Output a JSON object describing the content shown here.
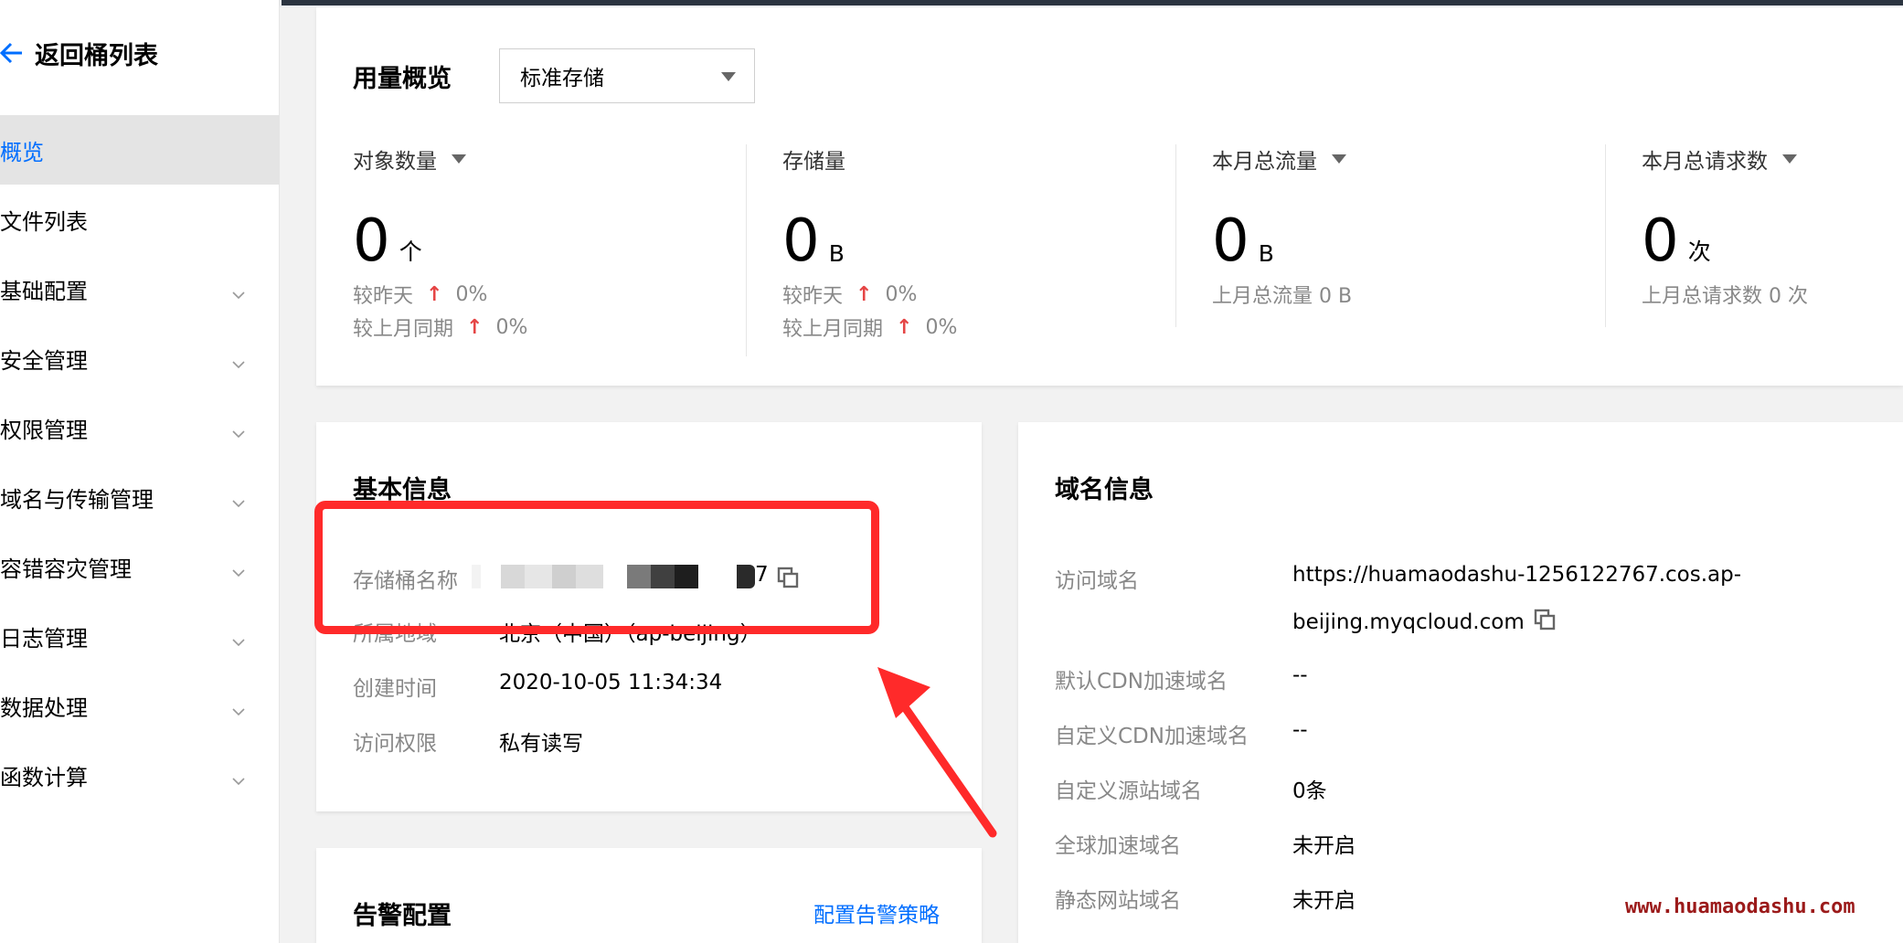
{
  "sidebar": {
    "back_label": "返回桶列表",
    "items": [
      {
        "label": "概览",
        "active": true,
        "has_chevron": false
      },
      {
        "label": "文件列表",
        "active": false,
        "has_chevron": false
      },
      {
        "label": "基础配置",
        "active": false,
        "has_chevron": true
      },
      {
        "label": "安全管理",
        "active": false,
        "has_chevron": true
      },
      {
        "label": "权限管理",
        "active": false,
        "has_chevron": true
      },
      {
        "label": "域名与传输管理",
        "active": false,
        "has_chevron": true
      },
      {
        "label": "容错容灾管理",
        "active": false,
        "has_chevron": true
      },
      {
        "label": "日志管理",
        "active": false,
        "has_chevron": true
      },
      {
        "label": "数据处理",
        "active": false,
        "has_chevron": true
      },
      {
        "label": "函数计算",
        "active": false,
        "has_chevron": true
      }
    ]
  },
  "usage": {
    "title": "用量概览",
    "storage_type": "标准存储",
    "stats": {
      "objects": {
        "label": "对象数量",
        "value": "0",
        "unit": "个",
        "line1_label": "较昨天",
        "line1_value": "0%",
        "line2_label": "较上月同期",
        "line2_value": "0%"
      },
      "storage": {
        "label": "存储量",
        "value": "0",
        "unit": "B",
        "line1_label": "较昨天",
        "line1_value": "0%",
        "line2_label": "较上月同期",
        "line2_value": "0%"
      },
      "traffic": {
        "label": "本月总流量",
        "value": "0",
        "unit": "B",
        "line1": "上月总流量 0 B"
      },
      "requests": {
        "label": "本月总请求数",
        "value": "0",
        "unit": "次",
        "line1": "上月总请求数 0 次"
      }
    }
  },
  "basic_info": {
    "title": "基本信息",
    "bucket_name_label": "存储桶名称",
    "bucket_name_visible_suffix": "7",
    "region_label": "所属地域",
    "region_value": "北京（中国）（ap-beijing）",
    "created_label": "创建时间",
    "created_value": "2020-10-05 11:34:34",
    "access_label": "访问权限",
    "access_value": "私有读写"
  },
  "alert_config": {
    "title": "告警配置",
    "link": "配置告警策略"
  },
  "domain_info": {
    "title": "域名信息",
    "access_domain_label": "访问域名",
    "access_domain_line1": "https://huamaodashu-1256122767.cos.ap-",
    "access_domain_line2": "beijing.myqcloud.com",
    "default_cdn_label": "默认CDN加速域名",
    "default_cdn_value": "--",
    "custom_cdn_label": "自定义CDN加速域名",
    "custom_cdn_value": "--",
    "custom_origin_label": "自定义源站域名",
    "custom_origin_value": "0条",
    "global_accel_label": "全球加速域名",
    "global_accel_value": "未开启",
    "static_site_label": "静态网站域名",
    "static_site_value": "未开启"
  },
  "watermark": "www.huamaodashu.com",
  "colors": {
    "accent": "#006eff",
    "up_arrow": "#e54545",
    "annotation": "#ff2a2a"
  }
}
